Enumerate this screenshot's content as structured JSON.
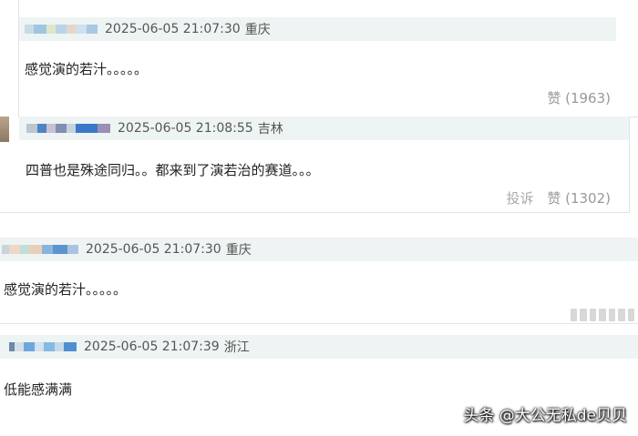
{
  "comments": [
    {
      "time": "2025-06-05 21:07:30",
      "location": "重庆",
      "text": "感觉演的若汁。。。。。",
      "likes": "赞 (1963)"
    },
    {
      "time": "2025-06-05 21:08:55",
      "location": "吉林",
      "text": "四普也是殊途同归。。都来到了演若治的赛道。。。",
      "report": "投诉",
      "likes": "赞 (1302)"
    },
    {
      "time": "2025-06-05 21:07:30",
      "location": "重庆",
      "text": "感觉演的若汁。。。。。"
    },
    {
      "time": "2025-06-05 21:07:39",
      "location": "浙江",
      "text": "低能感满满"
    }
  ],
  "watermark": "头条 @大公无私de贝贝",
  "colors": {
    "meta_bg": "#eef4f3",
    "text": "#222222",
    "meta_text": "#555555",
    "action_text": "#999999"
  }
}
